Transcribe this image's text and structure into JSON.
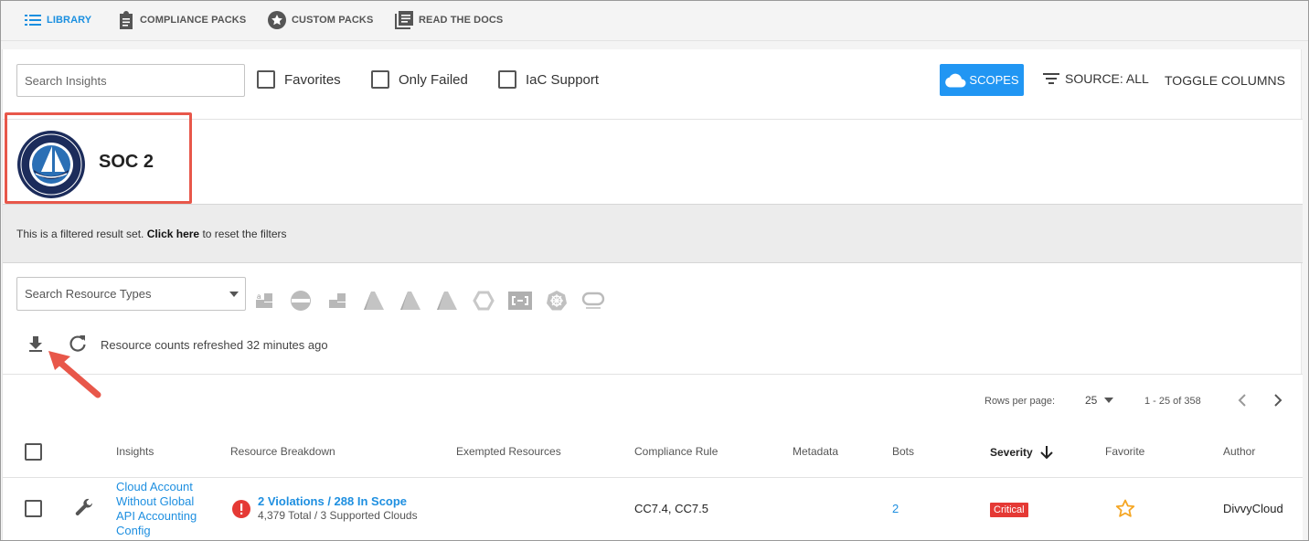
{
  "nav": {
    "library": "LIBRARY",
    "compliance_packs": "COMPLIANCE PACKS",
    "custom_packs": "CUSTOM PACKS",
    "read_docs": "READ THE DOCS"
  },
  "toolbar": {
    "search_placeholder": "Search Insights",
    "favorites": "Favorites",
    "only_failed": "Only Failed",
    "iac_support": "IaC Support",
    "scopes": "SCOPES",
    "source": "SOURCE: ALL",
    "toggle_columns": "TOGGLE COLUMNS"
  },
  "pack": {
    "title": "SOC 2",
    "logo": "soc2-type-ii-seal",
    "logo_text": "SOC 2 Type II ASSURE PROFESSIONAL"
  },
  "filter_notice": {
    "prefix": "This is a filtered result set.",
    "link": "Click here",
    "suffix": "to reset the filters"
  },
  "resources": {
    "search_placeholder": "Search Resource Types",
    "cloud_icons": [
      "aws-icon",
      "aws-govcloud-icon",
      "aws-china-icon",
      "azure-icon",
      "azure-gov-icon",
      "azure-china-icon",
      "gcp-icon",
      "alibaba-cloud-icon",
      "kubernetes-icon",
      "oracle-icon"
    ],
    "refresh_text": "Resource counts refreshed 32 minutes ago"
  },
  "pagination": {
    "rows_per_page_label": "Rows per page:",
    "rows_per_page": "25",
    "range": "1 - 25 of 358"
  },
  "columns": {
    "insights": "Insights",
    "resource_breakdown": "Resource Breakdown",
    "exempted_resources": "Exempted Resources",
    "compliance_rule": "Compliance Rule",
    "metadata": "Metadata",
    "bots": "Bots",
    "severity": "Severity",
    "favorite": "Favorite",
    "author": "Author"
  },
  "rows": [
    {
      "insight": "Cloud Account Without Global API Accounting Config",
      "violations": "2 Violations / 288 In Scope",
      "totals": "4,379 Total / 3 Supported Clouds",
      "compliance_rule": "CC7.4, CC7.5",
      "bots": "2",
      "severity": "Critical",
      "author": "DivvyCloud"
    }
  ],
  "colors": {
    "accent": "#2196f3",
    "link": "#1e8fe0",
    "critical": "#e53935",
    "annotation": "#e8574a",
    "star": "#f5a623"
  }
}
